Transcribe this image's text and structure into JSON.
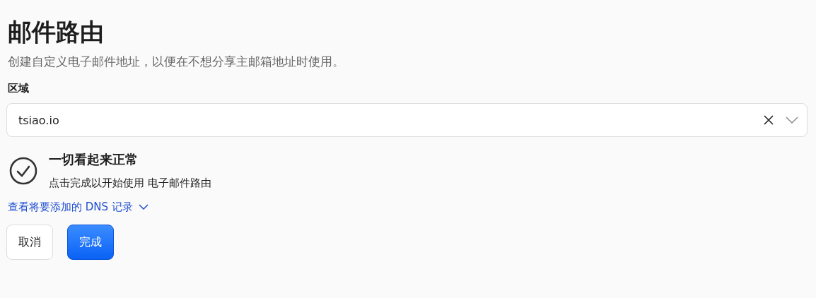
{
  "page": {
    "title": "邮件路由",
    "subtitle": "创建自定义电子邮件地址，以便在不想分享主邮箱地址时使用。"
  },
  "zone": {
    "label": "区域",
    "value": "tsiao.io"
  },
  "status": {
    "title": "一切看起来正常",
    "message": "点击完成以开始使用 电子邮件路由"
  },
  "dns_link": {
    "label": "查看将要添加的 DNS 记录",
    "expanded": false
  },
  "buttons": [
    {
      "label": "取消",
      "kind": "secondary"
    },
    {
      "label": "完成",
      "kind": "primary"
    }
  ]
}
